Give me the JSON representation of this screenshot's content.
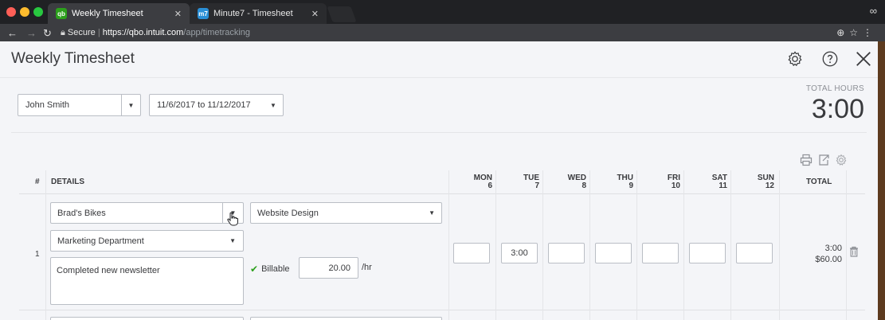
{
  "browser": {
    "tabs": [
      {
        "title": "Weekly Timesheet",
        "favicon": "qb",
        "favicon_color": "#2ca01c"
      },
      {
        "title": "Minute7 - Timesheet",
        "favicon": "m7",
        "favicon_color": "#2a8fd6"
      }
    ],
    "url_secure": "Secure",
    "url_host": "https://qbo.intuit.com",
    "url_path": "/app/timetracking"
  },
  "app": {
    "title": "Weekly Timesheet",
    "accent": "#2ca01c"
  },
  "filters": {
    "employee": "John Smith",
    "date_range": "11/6/2017 to 11/12/2017"
  },
  "total_hours": {
    "label": "TOTAL HOURS",
    "value": "3:00"
  },
  "grid": {
    "headers": {
      "number": "#",
      "details": "DETAILS",
      "total": "TOTAL"
    },
    "days": [
      {
        "name": "MON",
        "date": "6"
      },
      {
        "name": "TUE",
        "date": "7"
      },
      {
        "name": "WED",
        "date": "8"
      },
      {
        "name": "THU",
        "date": "9"
      },
      {
        "name": "FRI",
        "date": "10"
      },
      {
        "name": "SAT",
        "date": "11"
      },
      {
        "name": "SUN",
        "date": "12"
      }
    ],
    "rows": [
      {
        "number": "1",
        "customer": "Brad's Bikes",
        "service": "Website Design",
        "class": "Marketing Department",
        "description": "Completed new newsletter",
        "billable_label": "Billable",
        "rate": "20.00",
        "rate_unit": "/hr",
        "hours": [
          "",
          "3:00",
          "",
          "",
          "",
          "",
          ""
        ],
        "total_hours": "3:00",
        "total_amount": "$60.00"
      }
    ]
  }
}
